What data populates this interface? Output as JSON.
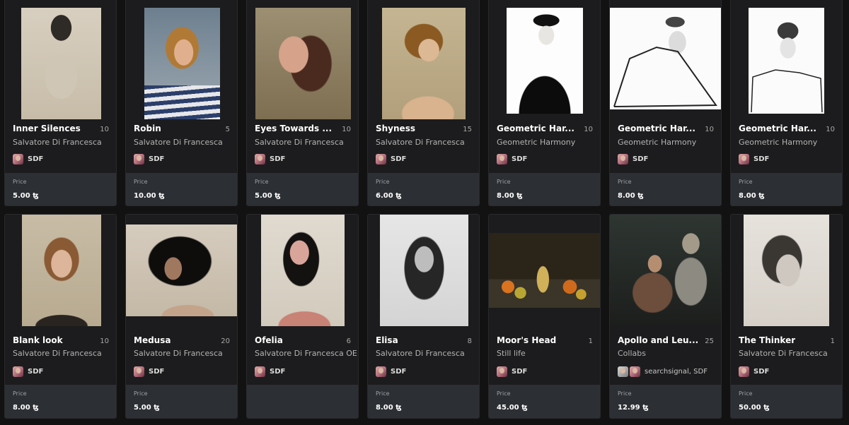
{
  "currency_symbol": "ꜩ",
  "price_label": "Price",
  "row1": [
    {
      "title": "Inner Silences",
      "edition": "10",
      "subtitle": "Salvatore Di Francesca",
      "creator": "SDF",
      "price": "5.00 ꜩ"
    },
    {
      "title": "Robin",
      "edition": "5",
      "subtitle": "Salvatore Di Francesca",
      "creator": "SDF",
      "price": "10.00 ꜩ"
    },
    {
      "title": "Eyes Towards ...",
      "edition": "10",
      "subtitle": "Salvatore Di Francesca",
      "creator": "SDF",
      "price": "5.00 ꜩ"
    },
    {
      "title": "Shyness",
      "edition": "15",
      "subtitle": "Salvatore Di Francesca",
      "creator": "SDF",
      "price": "6.00 ꜩ"
    },
    {
      "title": "Geometric Har...",
      "edition": "10",
      "subtitle": "Geometric Harmony",
      "creator": "SDF",
      "price": "8.00 ꜩ"
    },
    {
      "title": "Geometric Har...",
      "edition": "10",
      "subtitle": "Geometric Harmony",
      "creator": "SDF",
      "price": "8.00 ꜩ"
    },
    {
      "title": "Geometric Har...",
      "edition": "10",
      "subtitle": "Geometric Harmony",
      "creator": "SDF",
      "price": "8.00 ꜩ"
    }
  ],
  "row2": [
    {
      "title": "Blank look",
      "edition": "10",
      "subtitle": "Salvatore Di Francesca",
      "creator": "SDF",
      "price": "8.00 ꜩ"
    },
    {
      "title": "Medusa",
      "edition": "20",
      "subtitle": "Salvatore Di Francesca",
      "creator": "SDF",
      "price": "5.00 ꜩ"
    },
    {
      "title": "Ofelia",
      "edition": "6",
      "subtitle": "Salvatore Di Francesca OE",
      "creator": "SDF",
      "price": ""
    },
    {
      "title": "Elisa",
      "edition": "8",
      "subtitle": "Salvatore Di Francesca",
      "creator": "SDF",
      "price": "8.00 ꜩ"
    },
    {
      "title": "Moor's Head",
      "edition": "1",
      "subtitle": "Still life",
      "creator": "SDF",
      "price": "45.00 ꜩ"
    },
    {
      "title": "Apollo and Leu...",
      "edition": "25",
      "subtitle": "Collabs",
      "creator": "searchsignal, SDF",
      "price": "12.99 ꜩ"
    },
    {
      "title": "The Thinker",
      "edition": "1",
      "subtitle": "Salvatore Di Francesca",
      "creator": "SDF",
      "price": "50.00 ꜩ"
    }
  ],
  "colors": {
    "page_bg": "#121212",
    "card_bg": "#1c1c1e",
    "price_bg": "#2c2f33",
    "title": "#ffffff",
    "muted": "#b4b4b4"
  }
}
